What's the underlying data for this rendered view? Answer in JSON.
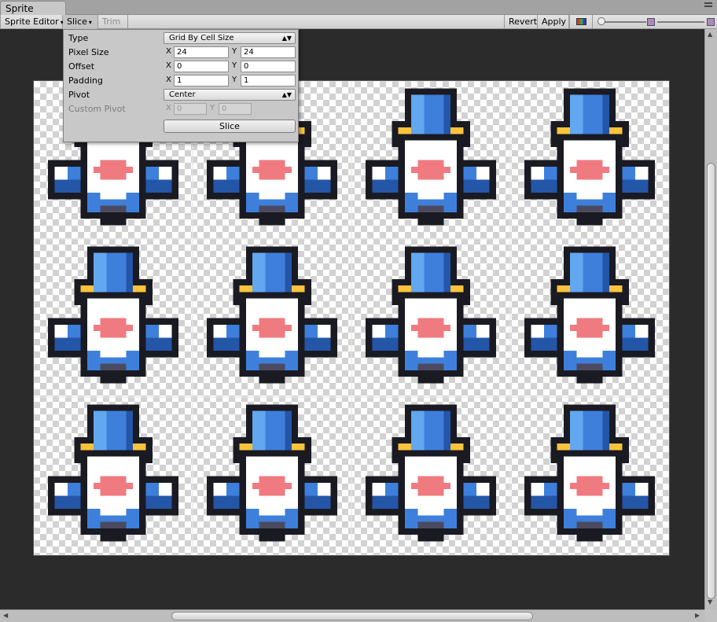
{
  "window": {
    "tab_title": "Sprite Editor"
  },
  "toolbar": {
    "mode_dropdown": "Sprite Editor",
    "slice_menu": "Slice",
    "trim": "Trim",
    "revert": "Revert",
    "apply": "Apply",
    "color_toggle_icon": "rgb-channel-icon",
    "zoom_slider_value": 0.0,
    "mip_slider_value": 1.0
  },
  "slice_popup": {
    "type_label": "Type",
    "type_value": "Grid By Cell Size",
    "pixel_size_label": "Pixel Size",
    "pixel_size_x": "24",
    "pixel_size_y": "24",
    "offset_label": "Offset",
    "offset_x": "0",
    "offset_y": "0",
    "padding_label": "Padding",
    "padding_x": "1",
    "padding_y": "1",
    "pivot_label": "Pivot",
    "pivot_value": "Center",
    "custom_pivot_label": "Custom Pivot",
    "custom_pivot_x": "0",
    "custom_pivot_y": "0",
    "x_axis": "X",
    "y_axis": "Y",
    "slice_button": "Slice"
  },
  "sprite_sheet": {
    "rows": 3,
    "columns": 4,
    "sprite": "blue-spaceship-icon",
    "colors": {
      "blue": "#3e7fdb",
      "blue_light": "#62a8f0",
      "blue_dark": "#2456a8",
      "yellow": "#fbc33b",
      "white": "#ffffff",
      "pink": "#ef7b80",
      "outline": "#1a1a22",
      "shadow": "#4c4a60"
    }
  },
  "scrollbars": {
    "vertical_position": 0.8,
    "horizontal_position": 0.5
  }
}
